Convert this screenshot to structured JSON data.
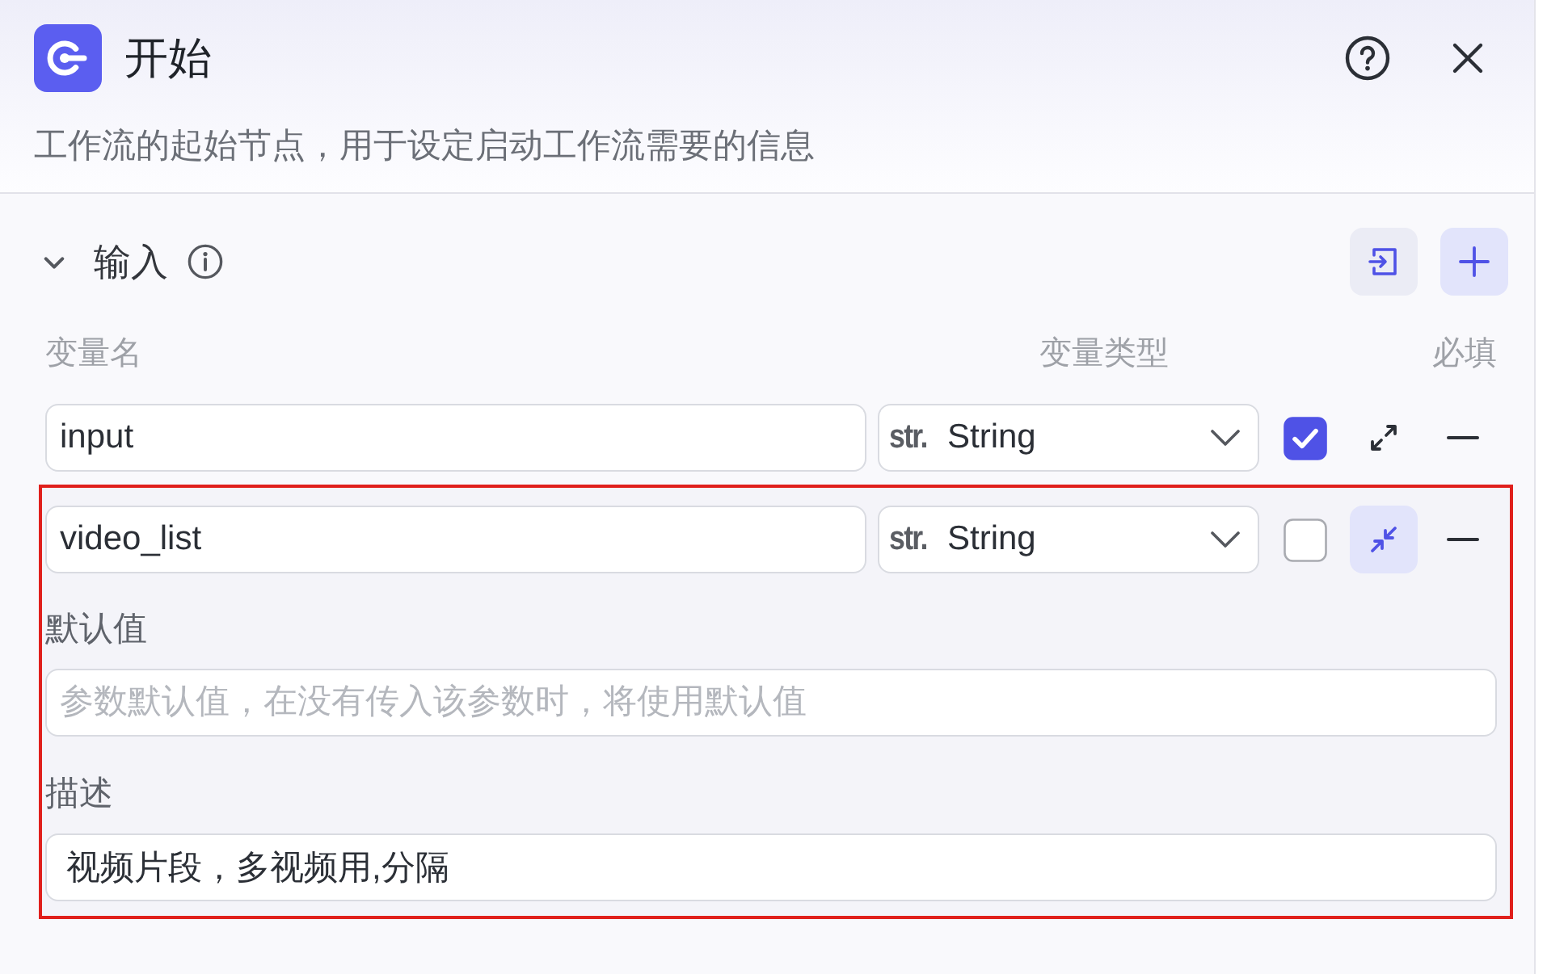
{
  "header": {
    "title": "开始",
    "subtitle": "工作流的起始节点，用于设定启动工作流需要的信息"
  },
  "section": {
    "title": "输入",
    "expanded": true
  },
  "columns": [
    "变量名",
    "变量类型",
    "必填"
  ],
  "variables": [
    {
      "name": "input",
      "type_prefix": "str.",
      "type": "String",
      "required": true,
      "expanded": false,
      "highlighted": false
    },
    {
      "name": "video_list",
      "type_prefix": "str.",
      "type": "String",
      "required": false,
      "expanded": true,
      "highlighted": true,
      "default": {
        "label": "默认值",
        "placeholder": "参数默认值，在没有传入该参数时，将使用默认值"
      },
      "description": {
        "label": "描述",
        "value": "视频片段，多视频用,分隔"
      }
    }
  ]
}
